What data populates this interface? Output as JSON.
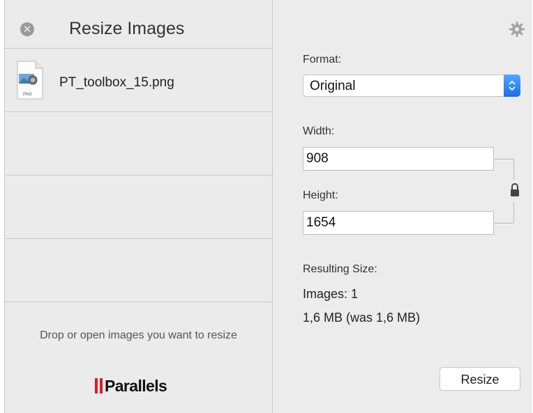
{
  "window": {
    "title": "Resize Images"
  },
  "file_list": {
    "items": [
      {
        "name": "PT_toolbox_15.png",
        "icon": "png-file-icon",
        "icon_label": "PNG"
      }
    ],
    "drop_hint": "Drop or open images you want to resize"
  },
  "branding": {
    "logo_text": "Parallels",
    "accent_color": "#e01a22"
  },
  "settings": {
    "format_label": "Format:",
    "format_value": "Original",
    "width_label": "Width:",
    "width_value": "908",
    "height_label": "Height:",
    "height_value": "1654",
    "aspect_lock": "lock-icon"
  },
  "result": {
    "label": "Resulting Size:",
    "images": "Images: 1",
    "size": "1,6 MB (was 1,6 MB)"
  },
  "actions": {
    "resize_label": "Resize"
  },
  "colors": {
    "stepper_blue": "#1a6fe6"
  }
}
